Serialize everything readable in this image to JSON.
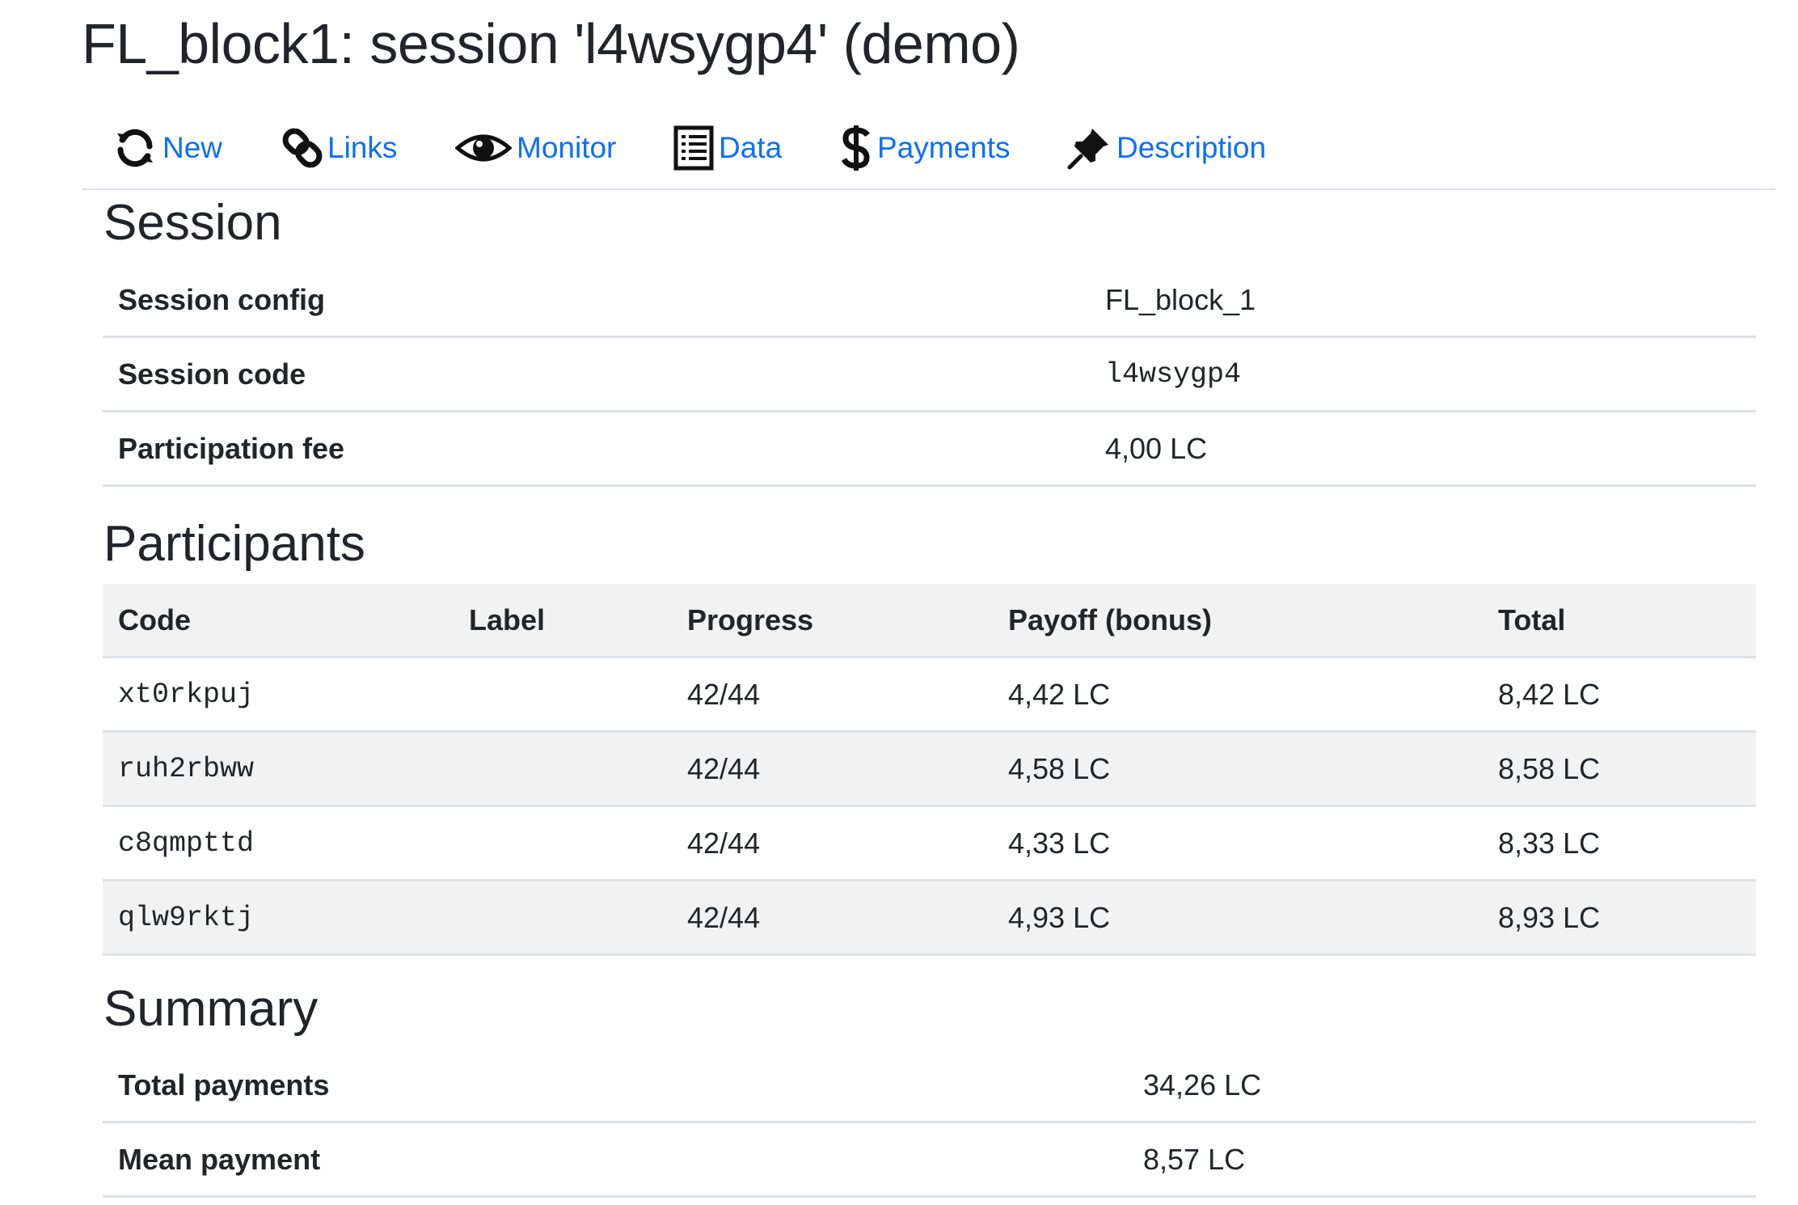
{
  "page": {
    "title": "FL_block1: session 'l4wsygp4' (demo)"
  },
  "nav": {
    "items": [
      {
        "label": "New",
        "icon": "refresh-icon"
      },
      {
        "label": "Links",
        "icon": "link-icon"
      },
      {
        "label": "Monitor",
        "icon": "eye-icon"
      },
      {
        "label": "Data",
        "icon": "list-icon"
      },
      {
        "label": "Payments",
        "icon": "dollar-icon"
      },
      {
        "label": "Description",
        "icon": "pushpin-icon"
      }
    ],
    "link_color": "#0d6efd"
  },
  "session": {
    "heading": "Session",
    "rows": [
      {
        "label": "Session config",
        "value": "FL_block_1"
      },
      {
        "label": "Session code",
        "value": "l4wsygp4"
      },
      {
        "label": "Participation fee",
        "value": "4,00 LC"
      }
    ]
  },
  "participants": {
    "heading": "Participants",
    "columns": [
      "Code",
      "Label",
      "Progress",
      "Payoff (bonus)",
      "Total"
    ],
    "rows": [
      {
        "code": "xt0rkpuj",
        "label": "",
        "progress": "42/44",
        "payoff": "4,42 LC",
        "total": "8,42 LC"
      },
      {
        "code": "ruh2rbww",
        "label": "",
        "progress": "42/44",
        "payoff": "4,58 LC",
        "total": "8,58 LC"
      },
      {
        "code": "c8qmpttd",
        "label": "",
        "progress": "42/44",
        "payoff": "4,33 LC",
        "total": "8,33 LC"
      },
      {
        "code": "qlw9rktj",
        "label": "",
        "progress": "42/44",
        "payoff": "4,93 LC",
        "total": "8,93 LC"
      }
    ]
  },
  "summary": {
    "heading": "Summary",
    "rows": [
      {
        "label": "Total payments",
        "value": "34,26 LC"
      },
      {
        "label": "Mean payment",
        "value": "8,57 LC"
      }
    ]
  }
}
